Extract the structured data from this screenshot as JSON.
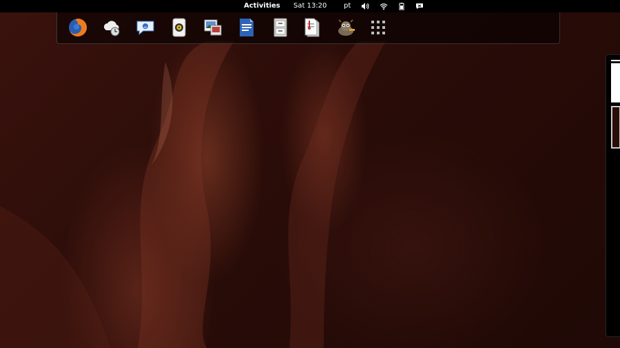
{
  "topbar": {
    "activities_label": "Activities",
    "clock": "Sat 13:20",
    "keyboard_layout": "pt",
    "tray_icons": [
      "volume-icon",
      "wifi-icon",
      "battery-icon",
      "chat-status-icon"
    ]
  },
  "dash": {
    "apps": [
      {
        "name": "firefox",
        "icon": "firefox-icon"
      },
      {
        "name": "weather-clock",
        "icon": "weather-clock-icon"
      },
      {
        "name": "empathy-chat",
        "icon": "chat-bubble-icon"
      },
      {
        "name": "rhythmbox",
        "icon": "music-player-icon"
      },
      {
        "name": "shotwell",
        "icon": "photo-viewer-icon"
      },
      {
        "name": "writer",
        "icon": "document-writer-icon"
      },
      {
        "name": "file-cabinet",
        "icon": "file-cabinet-icon"
      },
      {
        "name": "document-viewer",
        "icon": "document-viewer-icon"
      },
      {
        "name": "gimp",
        "icon": "gimp-icon"
      },
      {
        "name": "show-applications",
        "icon": "app-grid-icon"
      }
    ]
  },
  "workspaces": {
    "count": 2,
    "active_index": 1
  },
  "colors": {
    "topbar_bg": "#000000",
    "wallpaper_base": "#2a0c08",
    "accent_text": "#ffffff"
  }
}
